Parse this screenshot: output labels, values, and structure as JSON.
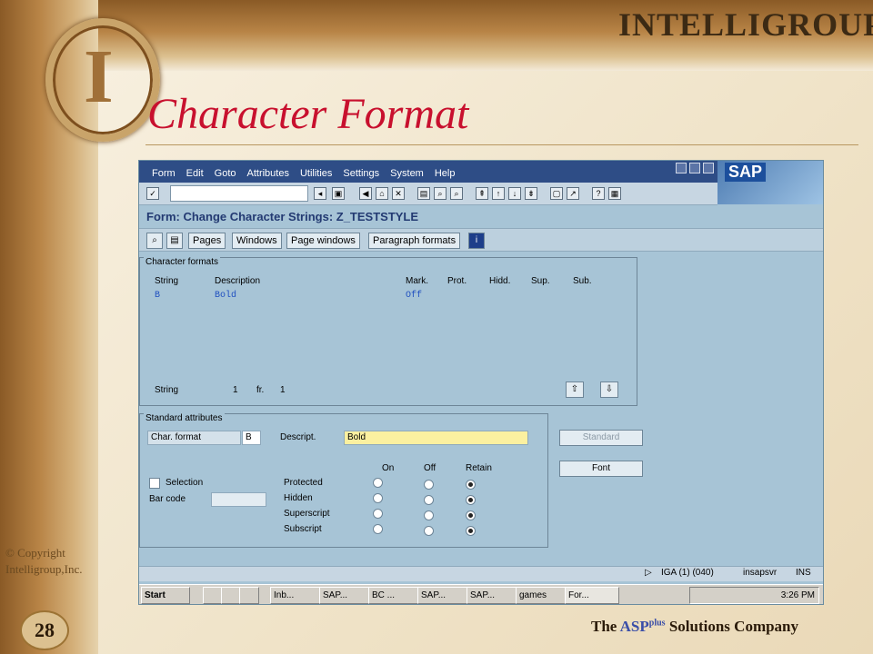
{
  "slide": {
    "brand": "INTELLIGROUP",
    "title": "Character Format",
    "copyright_line1": "© Copyright",
    "copyright_line2": "Intelligroup,Inc.",
    "page_number": "28",
    "tagline_prefix": "The ",
    "tagline_asp": "ASP",
    "tagline_sup": "plus",
    "tagline_suffix": " Solutions Company"
  },
  "sap": {
    "menu": [
      "Form",
      "Edit",
      "Goto",
      "Attributes",
      "Utilities",
      "Settings",
      "System",
      "Help"
    ],
    "logo": "SAP",
    "screen_title": "Form: Change Character Strings: Z_TESTSTYLE",
    "app_buttons": [
      "Pages",
      "Windows",
      "Page windows",
      "Paragraph formats"
    ],
    "char_formats": {
      "frame_title": "Character formats",
      "headers": [
        "String",
        "Description",
        "Mark.",
        "Prot.",
        "Hidd.",
        "Sup.",
        "Sub."
      ],
      "rows": [
        {
          "string": "B",
          "description": "Bold",
          "mark": "Off"
        }
      ],
      "footer_label": "String",
      "footer_value": "1",
      "footer_fr": "fr.",
      "footer_total": "1"
    },
    "std_attrs": {
      "frame_title": "Standard attributes",
      "char_format_label": "Char. format",
      "char_format_value": "B",
      "descript_label": "Descript.",
      "descript_value": "Bold",
      "col_on": "On",
      "col_off": "Off",
      "col_retain": "Retain",
      "selection_label": "Selection",
      "barcode_label": "Bar code",
      "rows": [
        "Protected",
        "Hidden",
        "Superscript",
        "Subscript"
      ]
    },
    "side_buttons": {
      "standard": "Standard",
      "font": "Font"
    },
    "status": {
      "session": "IGA (1) (040)",
      "server": "insapsvr",
      "mode": "INS"
    },
    "taskbar": {
      "start": "Start",
      "items": [
        "Inb...",
        "SAP...",
        "BC ...",
        "SAP...",
        "SAP...",
        "games",
        "For..."
      ],
      "clock": "3:26 PM"
    }
  }
}
